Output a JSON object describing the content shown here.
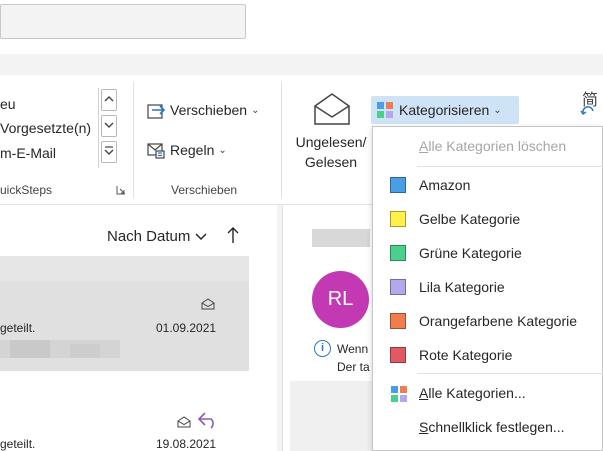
{
  "colors": {
    "accent": "#2b78c5",
    "highlight": "#cfe3f7",
    "avatar": "#c239b3",
    "category_amazon": "#4a9ee6",
    "category_gelb": "#fff04a",
    "category_gruen": "#4ad08a",
    "category_lila": "#b3a8ec",
    "category_orange": "#ef7d4d",
    "category_rot": "#e05a66"
  },
  "quicksteps": {
    "items": [
      "eu",
      "Vorgesetzte(n)",
      "m-E-Mail"
    ],
    "group_label": "uickSteps"
  },
  "verschieben": {
    "move_label": "Verschieben",
    "rules_label": "Regeln",
    "group_label": "Verschieben"
  },
  "tags": {
    "unread_line1": "Ungelesen/",
    "unread_line2": "Gelesen",
    "categorize_label": "Kategorisieren"
  },
  "category_menu": {
    "clear_all_prefix": "A",
    "clear_all_rest": "lle Kategorien löschen",
    "items": [
      {
        "label": "Amazon",
        "color_key": "category_amazon"
      },
      {
        "label": "Gelbe Kategorie",
        "color_key": "category_gelb"
      },
      {
        "label": "Grüne Kategorie",
        "color_key": "category_gruen"
      },
      {
        "label": "Lila Kategorie",
        "color_key": "category_lila"
      },
      {
        "label": "Orangefarbene Kategorie",
        "color_key": "category_orange"
      },
      {
        "label": "Rote Kategorie",
        "color_key": "category_rot"
      }
    ],
    "all_categories_prefix": "A",
    "all_categories_rest": "lle Kategorien...",
    "quick_click_prefix": "S",
    "quick_click_rest": "chnellklick festlegen..."
  },
  "mail_list": {
    "sort_label": "Nach Datum",
    "rows": [
      {
        "snippet": "geteilt.",
        "date": "01.09.2021"
      },
      {
        "snippet": "geteilt.",
        "date": "19.08.2021"
      }
    ]
  },
  "reading_pane": {
    "avatar_initials": "RL",
    "info_line1": "Wenn",
    "info_line2": "Der ta"
  },
  "ribbon_right": {
    "glyph": "简"
  }
}
